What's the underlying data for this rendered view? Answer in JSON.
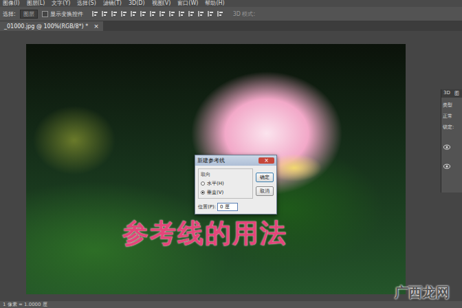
{
  "menu": [
    "图像(I)",
    "图层(L)",
    "文字(Y)",
    "选择(S)",
    "滤镜(T)",
    "3D(D)",
    "视图(V)",
    "窗口(W)",
    "帮助(H)"
  ],
  "options_bar": {
    "select_label": "选择:",
    "select_value": "图层",
    "transform": {
      "label": "显示变换控件",
      "checked": false
    },
    "mode_label": "3D 模式:"
  },
  "document_tab": {
    "title": "_01000.jpg @ 100%(RGB/8*) *",
    "close": "×"
  },
  "dialog": {
    "title": "新建参考线",
    "close": "×",
    "group": "取向",
    "options": [
      {
        "label": "水平(H)",
        "selected": false
      },
      {
        "label": "垂直(V)",
        "selected": true
      }
    ],
    "position_label": "位置(P):",
    "position_value": "0 厘",
    "buttons": [
      "确定",
      "取消"
    ]
  },
  "panel": {
    "tabs": [
      "3D",
      "图"
    ],
    "rows": [
      "类型",
      "正常",
      "锁定:"
    ]
  },
  "status_bar": "1 像素 = 1.0000 厘",
  "caption": "参考线的用法",
  "watermark": "广西龙网"
}
